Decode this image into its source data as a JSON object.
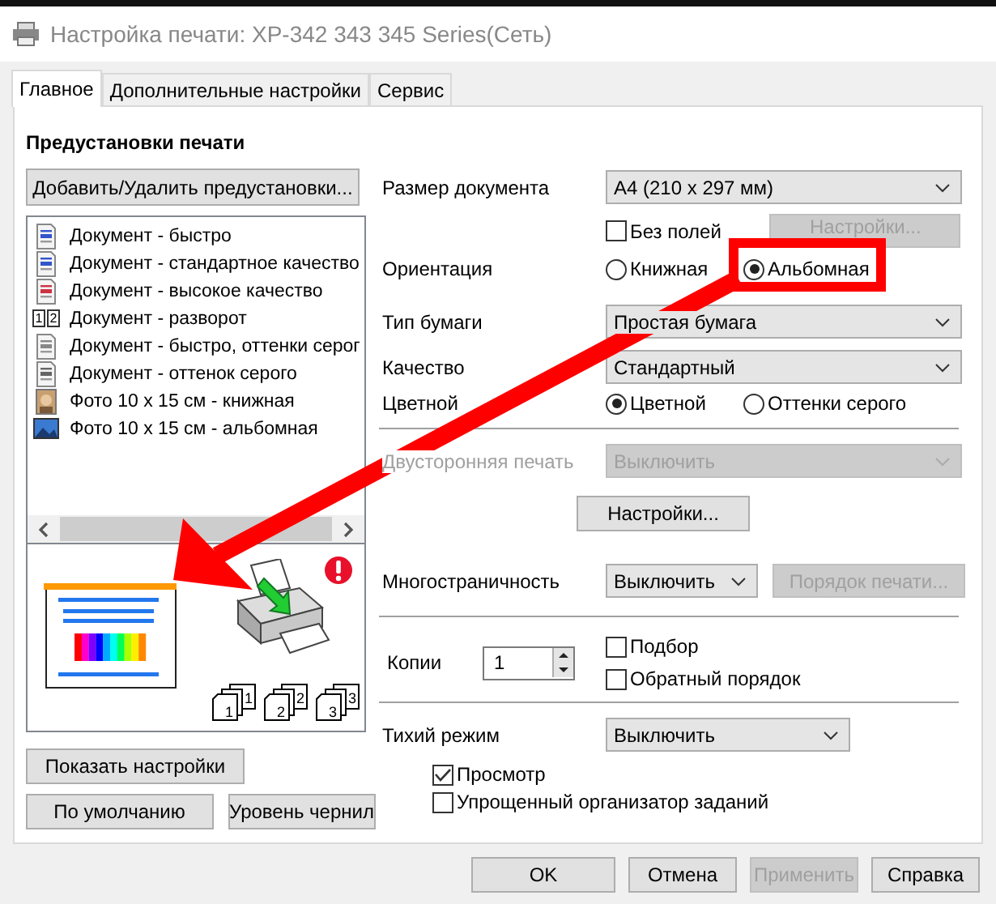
{
  "window": {
    "title": "Настройка печати: XP-342 343 345 Series(Сеть)"
  },
  "tabs": [
    {
      "label": "Главное",
      "selected": true
    },
    {
      "label": "Дополнительные настройки",
      "selected": false
    },
    {
      "label": "Сервис",
      "selected": false
    }
  ],
  "presets": {
    "heading": "Предустановки печати",
    "manage_button": "Добавить/Удалить предустановки...",
    "items": [
      {
        "label": "Документ - быстро",
        "kind": "doc"
      },
      {
        "label": "Документ - стандартное качество",
        "kind": "doc"
      },
      {
        "label": "Документ - высокое качество",
        "kind": "doc_hq"
      },
      {
        "label": "Документ - разворот",
        "kind": "spread",
        "icon_digits": [
          "1",
          "2"
        ]
      },
      {
        "label": "Документ - быстро, оттенки серог",
        "kind": "doc_gray"
      },
      {
        "label": "Документ - оттенок серого",
        "kind": "doc_gray_hq"
      },
      {
        "label": "Фото 10 x 15 см - книжная",
        "kind": "photo_portrait"
      },
      {
        "label": "Фото 10 x 15 см - альбомная",
        "kind": "photo_landscape"
      }
    ]
  },
  "preview": {
    "copies": [
      {
        "front": "1",
        "back": "1"
      },
      {
        "front": "2",
        "back": "2"
      },
      {
        "front": "3",
        "back": "3"
      }
    ]
  },
  "left_buttons": [
    {
      "label": "Показать настройки"
    },
    {
      "label": "По умолчанию"
    },
    {
      "label": "Уровень чернил"
    }
  ],
  "document_size": {
    "label": "Размер документа",
    "value": "A4 (210 x 297 мм)"
  },
  "borderless": {
    "label": "Без полей",
    "checked": false
  },
  "borderless_settings": {
    "label": "Настройки...",
    "disabled": true
  },
  "orientation": {
    "label": "Ориентация",
    "options": [
      {
        "label": "Книжная",
        "selected": false
      },
      {
        "label": "Альбомная",
        "selected": true
      }
    ]
  },
  "paper_type": {
    "label": "Тип бумаги",
    "value": "Простая бумага"
  },
  "quality": {
    "label": "Качество",
    "value": "Стандартный"
  },
  "color": {
    "label": "Цветной",
    "options": [
      {
        "label": "Цветной",
        "selected": true
      },
      {
        "label": "Оттенки серого",
        "selected": false
      }
    ]
  },
  "duplex": {
    "label": "Двусторонняя печать",
    "value": "Выключить",
    "disabled": true
  },
  "duplex_settings": {
    "label": "Настройки...",
    "disabled": false
  },
  "multipage": {
    "label": "Многостраничность",
    "value": "Выключить",
    "order_button": {
      "label": "Порядок печати...",
      "disabled": true
    }
  },
  "copies": {
    "label": "Копии",
    "value": "1",
    "collate": {
      "label": "Подбор",
      "checked": false
    },
    "reverse": {
      "label": "Обратный порядок",
      "checked": false
    }
  },
  "quiet_mode": {
    "label": "Тихий режим",
    "value": "Выключить"
  },
  "preview_check": {
    "label": "Просмотр",
    "checked": true
  },
  "job_arranger": {
    "label": "Упрощенный организатор заданий",
    "checked": false
  },
  "footer_buttons": [
    {
      "label": "OK",
      "disabled": false
    },
    {
      "label": "Отмена",
      "disabled": false
    },
    {
      "label": "Применить",
      "disabled": true
    },
    {
      "label": "Справка",
      "disabled": false
    }
  ]
}
